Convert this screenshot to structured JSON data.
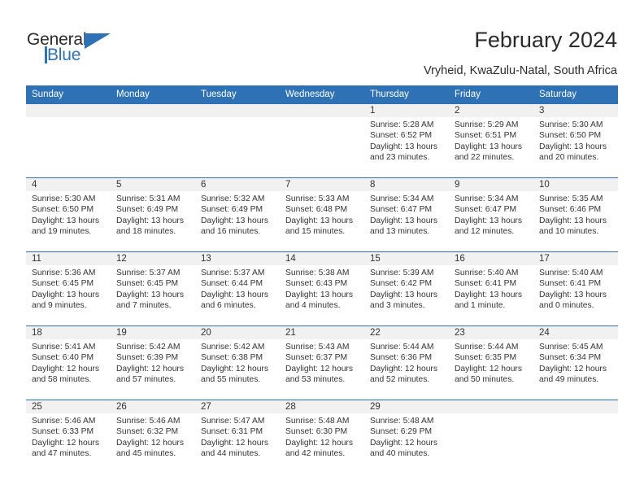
{
  "brand": {
    "name_part1": "General",
    "name_part2": "Blue",
    "accent_color": "#2e72b5"
  },
  "header": {
    "title": "February 2024",
    "subtitle": "Vryheid, KwaZulu-Natal, South Africa"
  },
  "weekdays": [
    "Sunday",
    "Monday",
    "Tuesday",
    "Wednesday",
    "Thursday",
    "Friday",
    "Saturday"
  ],
  "labels": {
    "sunrise_prefix": "Sunrise:",
    "sunset_prefix": "Sunset:",
    "daylight_prefix": "Daylight:"
  },
  "weeks": [
    [
      {
        "day": "",
        "empty": true
      },
      {
        "day": "",
        "empty": true
      },
      {
        "day": "",
        "empty": true
      },
      {
        "day": "",
        "empty": true
      },
      {
        "day": "1",
        "sunrise": "Sunrise: 5:28 AM",
        "sunset": "Sunset: 6:52 PM",
        "daylight1": "Daylight: 13 hours",
        "daylight2": "and 23 minutes."
      },
      {
        "day": "2",
        "sunrise": "Sunrise: 5:29 AM",
        "sunset": "Sunset: 6:51 PM",
        "daylight1": "Daylight: 13 hours",
        "daylight2": "and 22 minutes."
      },
      {
        "day": "3",
        "sunrise": "Sunrise: 5:30 AM",
        "sunset": "Sunset: 6:50 PM",
        "daylight1": "Daylight: 13 hours",
        "daylight2": "and 20 minutes."
      }
    ],
    [
      {
        "day": "4",
        "sunrise": "Sunrise: 5:30 AM",
        "sunset": "Sunset: 6:50 PM",
        "daylight1": "Daylight: 13 hours",
        "daylight2": "and 19 minutes."
      },
      {
        "day": "5",
        "sunrise": "Sunrise: 5:31 AM",
        "sunset": "Sunset: 6:49 PM",
        "daylight1": "Daylight: 13 hours",
        "daylight2": "and 18 minutes."
      },
      {
        "day": "6",
        "sunrise": "Sunrise: 5:32 AM",
        "sunset": "Sunset: 6:49 PM",
        "daylight1": "Daylight: 13 hours",
        "daylight2": "and 16 minutes."
      },
      {
        "day": "7",
        "sunrise": "Sunrise: 5:33 AM",
        "sunset": "Sunset: 6:48 PM",
        "daylight1": "Daylight: 13 hours",
        "daylight2": "and 15 minutes."
      },
      {
        "day": "8",
        "sunrise": "Sunrise: 5:34 AM",
        "sunset": "Sunset: 6:47 PM",
        "daylight1": "Daylight: 13 hours",
        "daylight2": "and 13 minutes."
      },
      {
        "day": "9",
        "sunrise": "Sunrise: 5:34 AM",
        "sunset": "Sunset: 6:47 PM",
        "daylight1": "Daylight: 13 hours",
        "daylight2": "and 12 minutes."
      },
      {
        "day": "10",
        "sunrise": "Sunrise: 5:35 AM",
        "sunset": "Sunset: 6:46 PM",
        "daylight1": "Daylight: 13 hours",
        "daylight2": "and 10 minutes."
      }
    ],
    [
      {
        "day": "11",
        "sunrise": "Sunrise: 5:36 AM",
        "sunset": "Sunset: 6:45 PM",
        "daylight1": "Daylight: 13 hours",
        "daylight2": "and 9 minutes."
      },
      {
        "day": "12",
        "sunrise": "Sunrise: 5:37 AM",
        "sunset": "Sunset: 6:45 PM",
        "daylight1": "Daylight: 13 hours",
        "daylight2": "and 7 minutes."
      },
      {
        "day": "13",
        "sunrise": "Sunrise: 5:37 AM",
        "sunset": "Sunset: 6:44 PM",
        "daylight1": "Daylight: 13 hours",
        "daylight2": "and 6 minutes."
      },
      {
        "day": "14",
        "sunrise": "Sunrise: 5:38 AM",
        "sunset": "Sunset: 6:43 PM",
        "daylight1": "Daylight: 13 hours",
        "daylight2": "and 4 minutes."
      },
      {
        "day": "15",
        "sunrise": "Sunrise: 5:39 AM",
        "sunset": "Sunset: 6:42 PM",
        "daylight1": "Daylight: 13 hours",
        "daylight2": "and 3 minutes."
      },
      {
        "day": "16",
        "sunrise": "Sunrise: 5:40 AM",
        "sunset": "Sunset: 6:41 PM",
        "daylight1": "Daylight: 13 hours",
        "daylight2": "and 1 minute."
      },
      {
        "day": "17",
        "sunrise": "Sunrise: 5:40 AM",
        "sunset": "Sunset: 6:41 PM",
        "daylight1": "Daylight: 13 hours",
        "daylight2": "and 0 minutes."
      }
    ],
    [
      {
        "day": "18",
        "sunrise": "Sunrise: 5:41 AM",
        "sunset": "Sunset: 6:40 PM",
        "daylight1": "Daylight: 12 hours",
        "daylight2": "and 58 minutes."
      },
      {
        "day": "19",
        "sunrise": "Sunrise: 5:42 AM",
        "sunset": "Sunset: 6:39 PM",
        "daylight1": "Daylight: 12 hours",
        "daylight2": "and 57 minutes."
      },
      {
        "day": "20",
        "sunrise": "Sunrise: 5:42 AM",
        "sunset": "Sunset: 6:38 PM",
        "daylight1": "Daylight: 12 hours",
        "daylight2": "and 55 minutes."
      },
      {
        "day": "21",
        "sunrise": "Sunrise: 5:43 AM",
        "sunset": "Sunset: 6:37 PM",
        "daylight1": "Daylight: 12 hours",
        "daylight2": "and 53 minutes."
      },
      {
        "day": "22",
        "sunrise": "Sunrise: 5:44 AM",
        "sunset": "Sunset: 6:36 PM",
        "daylight1": "Daylight: 12 hours",
        "daylight2": "and 52 minutes."
      },
      {
        "day": "23",
        "sunrise": "Sunrise: 5:44 AM",
        "sunset": "Sunset: 6:35 PM",
        "daylight1": "Daylight: 12 hours",
        "daylight2": "and 50 minutes."
      },
      {
        "day": "24",
        "sunrise": "Sunrise: 5:45 AM",
        "sunset": "Sunset: 6:34 PM",
        "daylight1": "Daylight: 12 hours",
        "daylight2": "and 49 minutes."
      }
    ],
    [
      {
        "day": "25",
        "sunrise": "Sunrise: 5:46 AM",
        "sunset": "Sunset: 6:33 PM",
        "daylight1": "Daylight: 12 hours",
        "daylight2": "and 47 minutes."
      },
      {
        "day": "26",
        "sunrise": "Sunrise: 5:46 AM",
        "sunset": "Sunset: 6:32 PM",
        "daylight1": "Daylight: 12 hours",
        "daylight2": "and 45 minutes."
      },
      {
        "day": "27",
        "sunrise": "Sunrise: 5:47 AM",
        "sunset": "Sunset: 6:31 PM",
        "daylight1": "Daylight: 12 hours",
        "daylight2": "and 44 minutes."
      },
      {
        "day": "28",
        "sunrise": "Sunrise: 5:48 AM",
        "sunset": "Sunset: 6:30 PM",
        "daylight1": "Daylight: 12 hours",
        "daylight2": "and 42 minutes."
      },
      {
        "day": "29",
        "sunrise": "Sunrise: 5:48 AM",
        "sunset": "Sunset: 6:29 PM",
        "daylight1": "Daylight: 12 hours",
        "daylight2": "and 40 minutes."
      },
      {
        "day": "",
        "empty": true
      },
      {
        "day": "",
        "empty": true
      }
    ]
  ]
}
